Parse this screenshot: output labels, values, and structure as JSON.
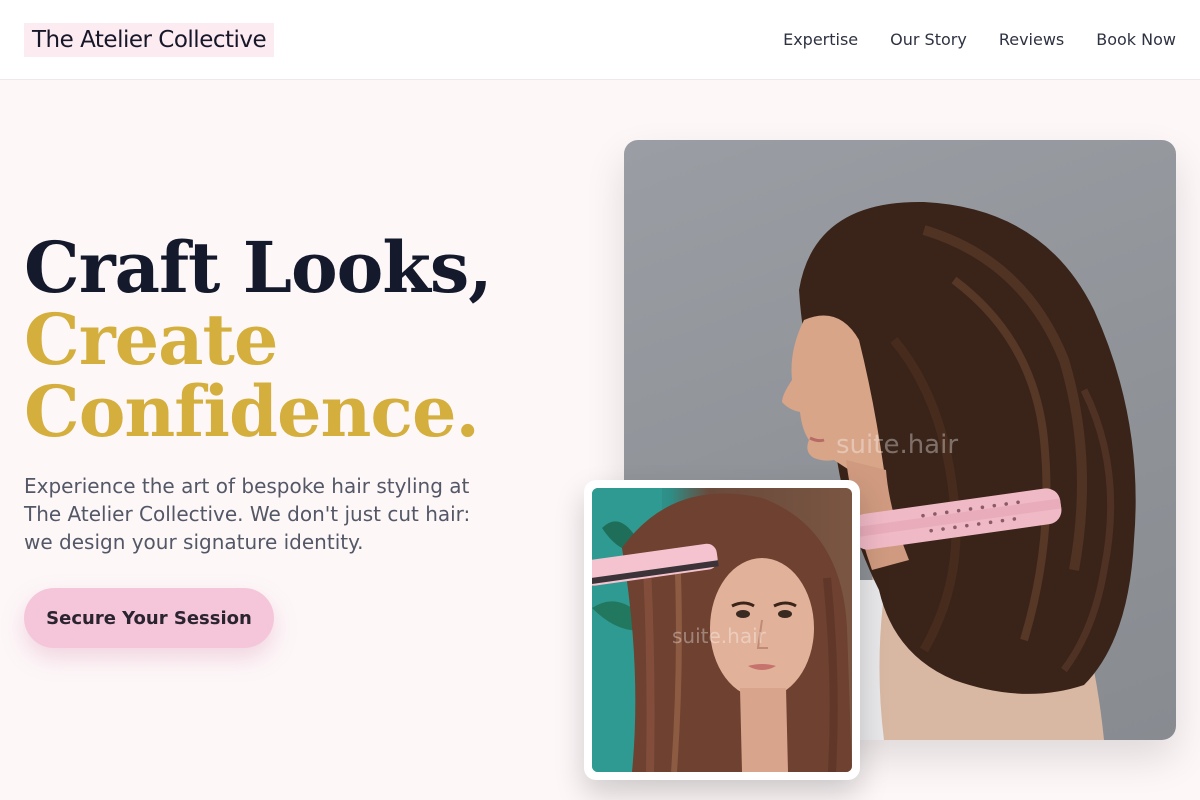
{
  "header": {
    "logo": "The Atelier Collective",
    "nav": [
      {
        "label": "Expertise"
      },
      {
        "label": "Our Story"
      },
      {
        "label": "Reviews"
      },
      {
        "label": "Book Now"
      }
    ]
  },
  "hero": {
    "title_line1": "Craft Looks,",
    "title_line2": "Create",
    "title_line3": "Confidence.",
    "subtitle": "Experience the art of bespoke hair styling at The Atelier Collective. We don't just cut hair: we design your signature identity.",
    "cta_label": "Secure Your Session"
  },
  "images": {
    "main_watermark": "suite.hair",
    "inset_watermark": "suite.hair"
  },
  "colors": {
    "accent_gold": "#d4af3e",
    "cta_pink": "#f5c6d9",
    "dark_text": "#141a2c"
  }
}
